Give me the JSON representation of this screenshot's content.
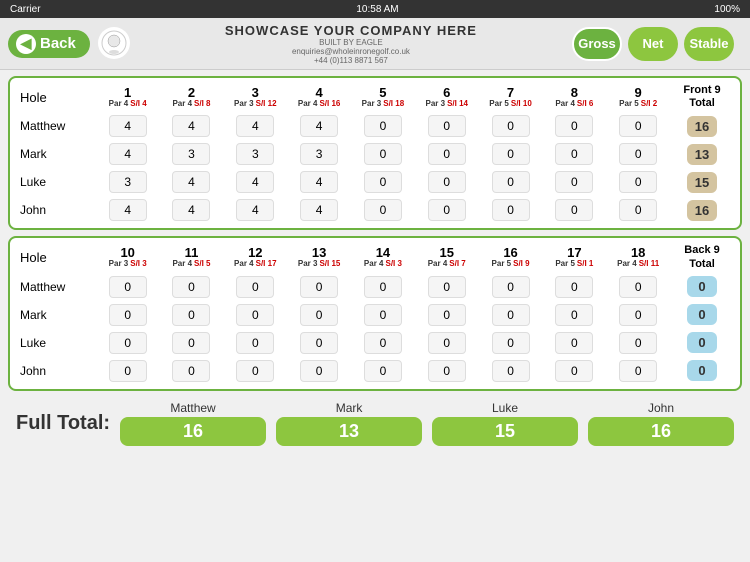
{
  "statusBar": {
    "carrier": "Carrier",
    "time": "10:58 AM",
    "signal": "100%"
  },
  "header": {
    "backLabel": "Back",
    "companyName": "SHOWCASE YOUR COMPANY HERE",
    "companyEmail": "enquiries@wholeinronegolf.co.uk",
    "companyPhone": "+44 (0)113 8871 567",
    "grossLabel": "Gross",
    "netLabel": "Net",
    "stableLabel": "Stable"
  },
  "front9": {
    "sectionTitle": "Front 9 Total",
    "holes": [
      {
        "number": "1",
        "par": "4",
        "si": "4"
      },
      {
        "number": "2",
        "par": "4",
        "si": "8"
      },
      {
        "number": "3",
        "par": "3",
        "si": "12"
      },
      {
        "number": "4",
        "par": "4",
        "si": "16"
      },
      {
        "number": "5",
        "par": "3",
        "si": "18"
      },
      {
        "number": "6",
        "par": "3",
        "si": "14"
      },
      {
        "number": "7",
        "par": "5",
        "si": "10"
      },
      {
        "number": "8",
        "par": "4",
        "si": "6"
      },
      {
        "number": "9",
        "par": "5",
        "si": "2"
      }
    ],
    "players": [
      {
        "name": "Matthew",
        "scores": [
          4,
          4,
          4,
          4,
          0,
          0,
          0,
          0,
          0
        ],
        "total": 16
      },
      {
        "name": "Mark",
        "scores": [
          4,
          3,
          3,
          3,
          0,
          0,
          0,
          0,
          0
        ],
        "total": 13
      },
      {
        "name": "Luke",
        "scores": [
          3,
          4,
          4,
          4,
          0,
          0,
          0,
          0,
          0
        ],
        "total": 15
      },
      {
        "name": "John",
        "scores": [
          4,
          4,
          4,
          4,
          0,
          0,
          0,
          0,
          0
        ],
        "total": 16
      }
    ]
  },
  "back9": {
    "sectionTitle": "Back 9 Total",
    "holes": [
      {
        "number": "10",
        "par": "3",
        "si": "3"
      },
      {
        "number": "11",
        "par": "4",
        "si": "5"
      },
      {
        "number": "12",
        "par": "4",
        "si": "17"
      },
      {
        "number": "13",
        "par": "3",
        "si": "15"
      },
      {
        "number": "14",
        "par": "4",
        "si": "3"
      },
      {
        "number": "15",
        "par": "4",
        "si": "7"
      },
      {
        "number": "16",
        "par": "5",
        "si": "9"
      },
      {
        "number": "17",
        "par": "5",
        "si": "1"
      },
      {
        "number": "18",
        "par": "4",
        "si": "11"
      }
    ],
    "players": [
      {
        "name": "Matthew",
        "scores": [
          0,
          0,
          0,
          0,
          0,
          0,
          0,
          0,
          0
        ],
        "total": 0
      },
      {
        "name": "Mark",
        "scores": [
          0,
          0,
          0,
          0,
          0,
          0,
          0,
          0,
          0
        ],
        "total": 0
      },
      {
        "name": "Luke",
        "scores": [
          0,
          0,
          0,
          0,
          0,
          0,
          0,
          0,
          0
        ],
        "total": 0
      },
      {
        "name": "John",
        "scores": [
          0,
          0,
          0,
          0,
          0,
          0,
          0,
          0,
          0
        ],
        "total": 0
      }
    ]
  },
  "fullTotal": {
    "label": "Full Total:",
    "players": [
      {
        "name": "Matthew",
        "total": 16
      },
      {
        "name": "Mark",
        "total": 13
      },
      {
        "name": "Luke",
        "total": 15
      },
      {
        "name": "John",
        "total": 16
      }
    ]
  }
}
